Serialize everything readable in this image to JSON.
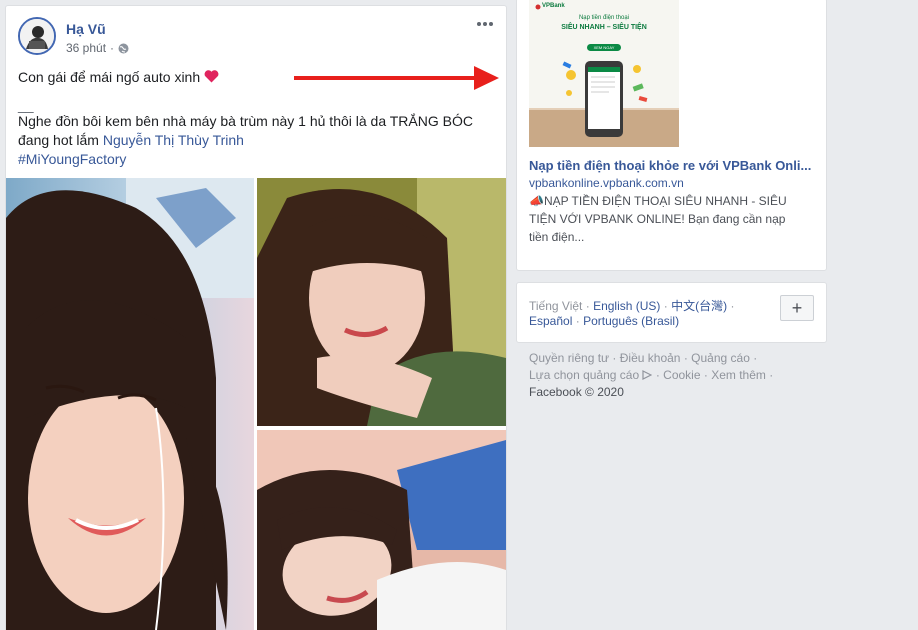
{
  "post": {
    "author": "Hạ Vũ",
    "time": "36 phút",
    "time_sep": "·",
    "line1": "Con gái để mái ngố auto xinh",
    "heart": "❤️",
    "divider": "__",
    "line2": "Nghe đồn bôi kem bên nhà máy bà trùm này 1 hủ thôi là da TRẮNG BÓC",
    "line3_prefix": "đang hot lắm ",
    "mention": "Nguyễn Thị Thùy Trinh",
    "hashtag": "#MiYoungFactory"
  },
  "ad": {
    "title": "Nạp tiền điện thoại khỏe re với VPBank Onli...",
    "domain": "vpbankonline.vpbank.com.vn",
    "desc_emoji": "📣",
    "desc_line1": "NẠP TIỀN ĐIỆN THOẠI SIÊU NHANH - SIÊU",
    "desc_line2": "TIỆN VỚI VPBANK ONLINE! Bạn đang cần nạp",
    "desc_line3": "tiền điện...",
    "image": {
      "brand": "VPBank",
      "heading": "Nạp tiền điện thoại",
      "subheading": "SIÊU NHANH – SIÊU TIỆN",
      "button": "XEM NGAY"
    }
  },
  "languages": {
    "active": "Tiếng Việt",
    "english": "English (US)",
    "chinese": "中文(台灣)",
    "spanish": "Español",
    "portuguese": "Português (Brasil)",
    "add_label": "+",
    "sep": "·"
  },
  "footer": {
    "privacy": "Quyền riêng tư",
    "terms": "Điều khoản",
    "advertising": "Quảng cáo",
    "ad_choices": "Lựa chọn quảng cáo",
    "cookie": "Cookie",
    "more": "Xem thêm",
    "copyright": "Facebook © 2020",
    "sep": "·"
  },
  "colors": {
    "link": "#385898",
    "background": "#e9ebee",
    "arrow": "#e8201c"
  }
}
